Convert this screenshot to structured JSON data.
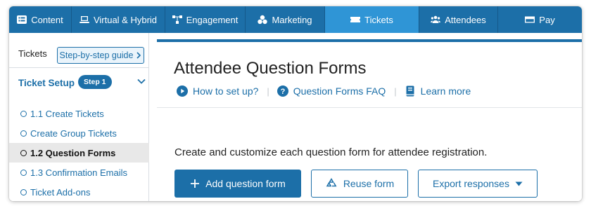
{
  "topnav": {
    "items": [
      {
        "label": "Content",
        "icon": "list-icon",
        "active": false
      },
      {
        "label": "Virtual & Hybrid",
        "icon": "laptop-icon",
        "active": false
      },
      {
        "label": "Engagement",
        "icon": "network-icon",
        "active": false
      },
      {
        "label": "Marketing",
        "icon": "shapes-icon",
        "active": false
      },
      {
        "label": "Tickets",
        "icon": "ticket-icon",
        "active": true
      },
      {
        "label": "Attendees",
        "icon": "users-icon",
        "active": false
      },
      {
        "label": "Pay",
        "icon": "credit-card-icon",
        "active": false
      }
    ]
  },
  "sidebar": {
    "tickets_label": "Tickets",
    "guide_button": "Step-by-step guide",
    "section_title": "Ticket Setup",
    "step_badge": "Step 1",
    "items": [
      {
        "label": "1.1 Create Tickets",
        "active": false
      },
      {
        "label": "Create Group Tickets",
        "active": false
      },
      {
        "label": "1.2 Question Forms",
        "active": true
      },
      {
        "label": "1.3 Confirmation Emails",
        "active": false
      },
      {
        "label": "Ticket Add-ons",
        "active": false
      }
    ]
  },
  "main": {
    "title": "Attendee Question Forms",
    "links": [
      {
        "label": "How to set up?",
        "icon": "play-circle-icon"
      },
      {
        "label": "Question Forms FAQ",
        "icon": "question-circle-icon"
      },
      {
        "label": "Learn more",
        "icon": "book-icon"
      }
    ],
    "description": "Create and customize each question form for attendee registration.",
    "buttons": {
      "add": "Add question form",
      "reuse": "Reuse form",
      "export": "Export responses"
    }
  },
  "colors": {
    "brand": "#1c6fa8",
    "nav_active": "#2f95d6",
    "sidebar_active_bg": "#e8e8e8"
  }
}
